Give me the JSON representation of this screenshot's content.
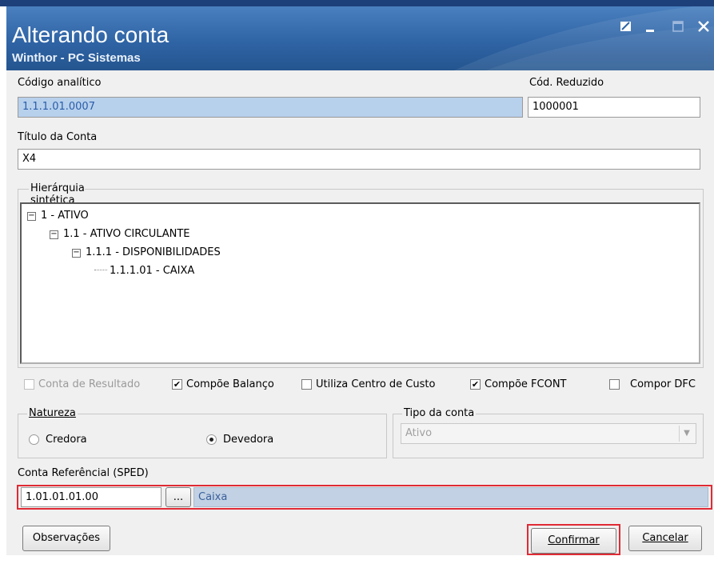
{
  "window": {
    "title": "Alterando conta",
    "subtitle": "Winthor - PC Sistemas"
  },
  "fields": {
    "codigo_analitico_label": "Código analítico",
    "codigo_analitico_value": "1.1.1.01.0007",
    "cod_reduzido_label": "Cód. Reduzido",
    "cod_reduzido_value": "1000001",
    "titulo_label": "Título da Conta",
    "titulo_value": "X4"
  },
  "hierarchy": {
    "label": "Hierárquia sintética da conta",
    "nodes": [
      "1 - ATIVO",
      "1.1 - ATIVO CIRCULANTE",
      "1.1.1 - DISPONIBILIDADES",
      "1.1.1.01 - CAIXA"
    ]
  },
  "options": {
    "conta_resultado": "Conta de Resultado",
    "compoe_balanco": "Compõe Balanço",
    "utiliza_centro_custo": "Utiliza Centro de Custo",
    "compoe_fcont": "Compõe FCONT",
    "compor_dfc": "Compor DFC"
  },
  "natureza": {
    "label": "Natureza",
    "credora": "Credora",
    "devedora": "Devedora",
    "selected": "Devedora"
  },
  "tipo_conta": {
    "label": "Tipo da conta",
    "value": "Ativo"
  },
  "referencial": {
    "label": "Conta Referêncial (SPED)",
    "code": "1.01.01.01.00",
    "lookup_label": "...",
    "description": "Caixa"
  },
  "buttons": {
    "observacoes": "Observações",
    "confirmar": "Confirmar",
    "cancelar": "Cancelar"
  },
  "colors": {
    "titlebar": "#2f64a5",
    "highlight_border": "#e02b35",
    "selection": "#b7d0ec"
  }
}
